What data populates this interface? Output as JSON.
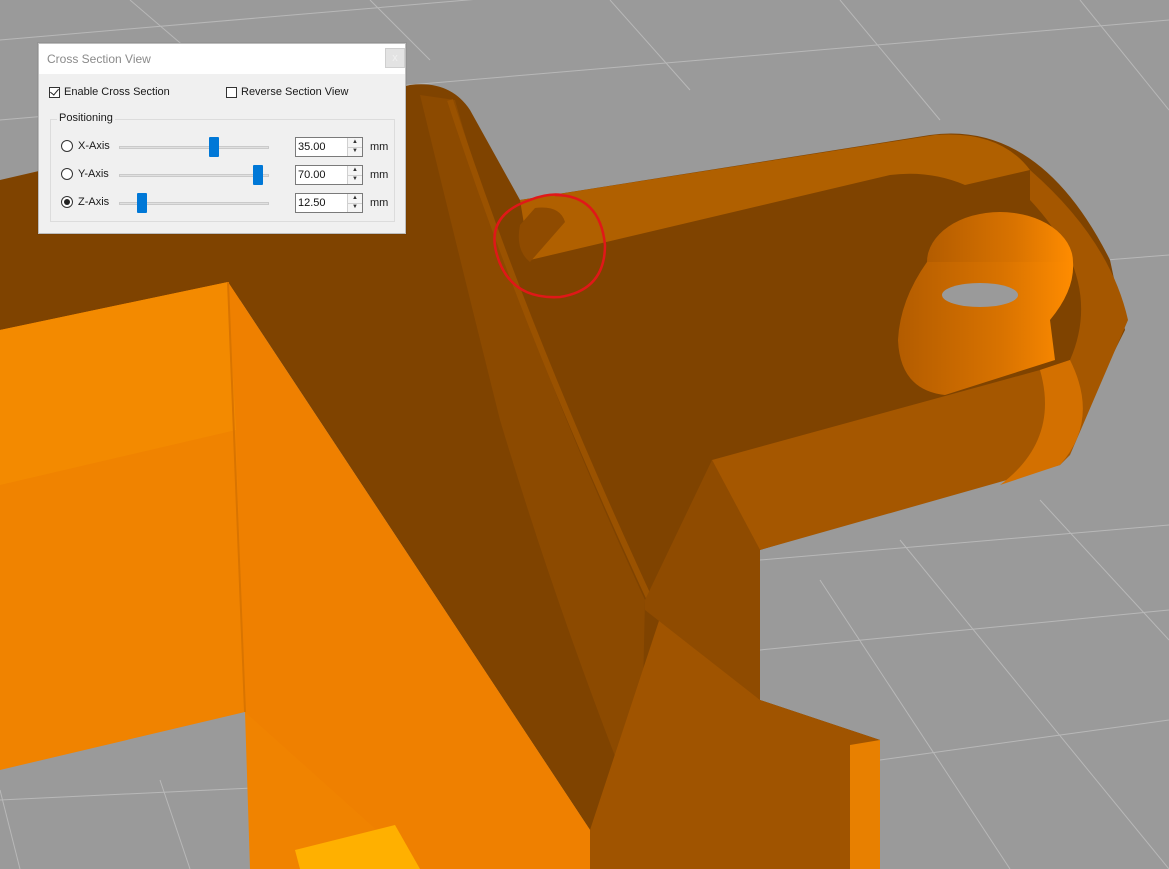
{
  "dialog": {
    "title": "Cross Section View",
    "close_label": "x",
    "enable_cross_section": {
      "label": "Enable Cross Section",
      "checked": true
    },
    "reverse_section_view": {
      "label": "Reverse Section View",
      "checked": false
    },
    "positioning": {
      "legend": "Positioning",
      "axes": [
        {
          "label": "X-Axis",
          "value": "35.00",
          "unit": "mm",
          "selected": false,
          "slider_level": 0.63
        },
        {
          "label": "Y-Axis",
          "value": "70.00",
          "unit": "mm",
          "selected": false,
          "slider_level": 0.93
        },
        {
          "label": "Z-Axis",
          "value": "12.50",
          "unit": "mm",
          "selected": true,
          "slider_level": 0.15
        }
      ]
    }
  },
  "colors": {
    "model_dark": "#7f4300",
    "model_mid": "#a95a00",
    "model_light": "#f08300",
    "annotation": "#e01818",
    "slider_thumb": "#0078d7",
    "grid_bg": "#9a9a9a"
  }
}
